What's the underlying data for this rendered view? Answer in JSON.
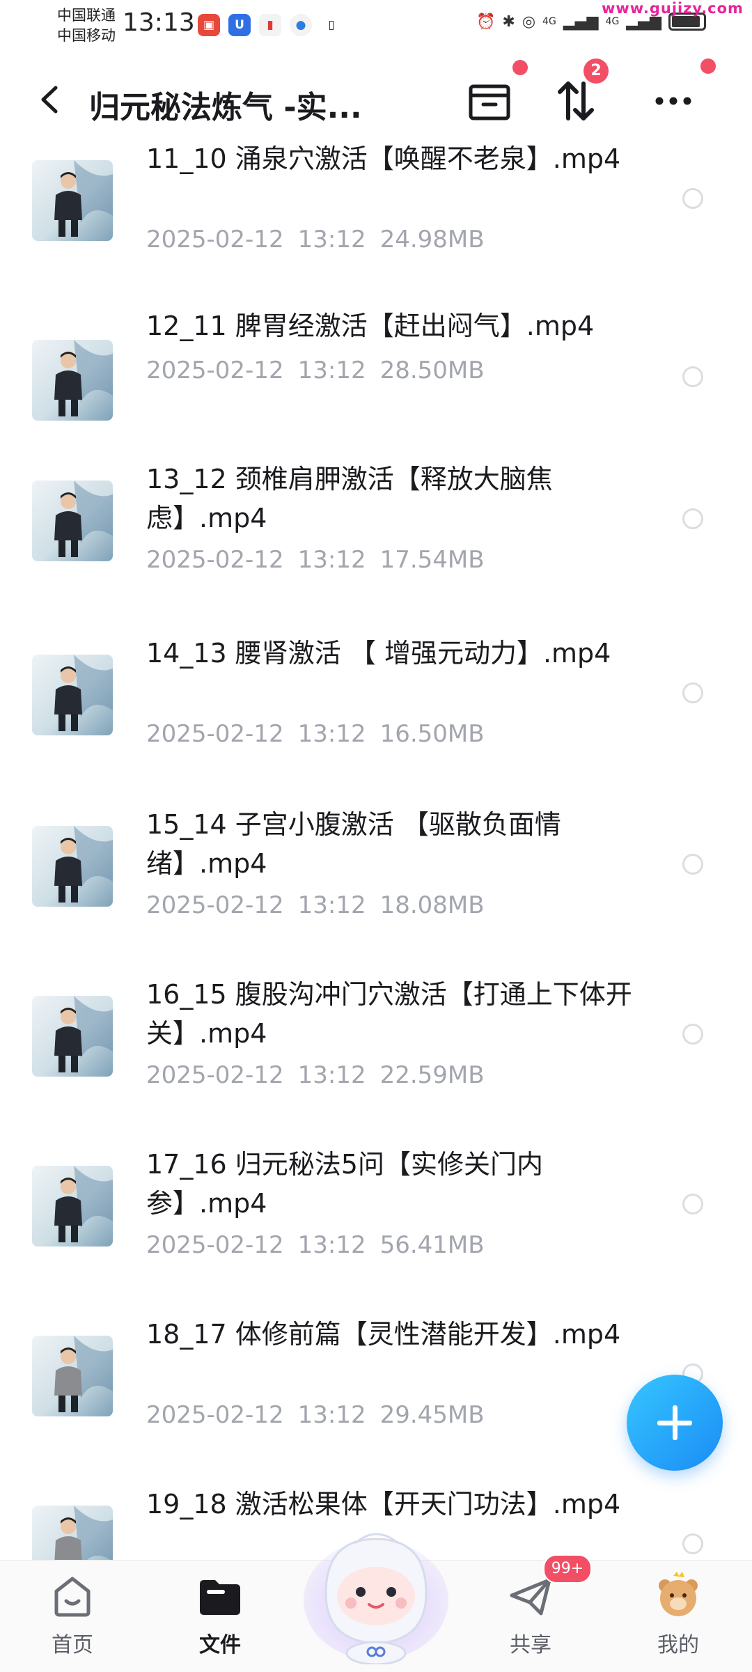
{
  "status_bar": {
    "carrier_1": "中国联通",
    "carrier_2": "中国移动",
    "time": "13:13",
    "network_1": "4G",
    "network_2": "4G",
    "watermark": "www.gujizy.com"
  },
  "header": {
    "title": "归元秘法炼气 -实...",
    "sort_badge": "2"
  },
  "files": [
    {
      "name": "11_10 涌泉穴激活【唤醒不老泉】.mp4",
      "date": "2025-02-12",
      "time": "13:12",
      "size": "24.98MB"
    },
    {
      "name": "12_11 脾胃经激活【赶出闷气】.mp4",
      "date": "2025-02-12",
      "time": "13:12",
      "size": "28.50MB"
    },
    {
      "name": "13_12 颈椎肩胛激活【释放大脑焦虑】.mp4",
      "date": "2025-02-12",
      "time": "13:12",
      "size": "17.54MB"
    },
    {
      "name": "14_13 腰肾激活 【 增强元动力】.mp4",
      "date": "2025-02-12",
      "time": "13:12",
      "size": "16.50MB"
    },
    {
      "name": "15_14 子宫小腹激活 【驱散负面情绪】.mp4",
      "date": "2025-02-12",
      "time": "13:12",
      "size": "18.08MB"
    },
    {
      "name": "16_15 腹股沟冲门穴激活【打通上下体开关】.mp4",
      "date": "2025-02-12",
      "time": "13:12",
      "size": "22.59MB"
    },
    {
      "name": "17_16 归元秘法5问【实修关门内参】.mp4",
      "date": "2025-02-12",
      "time": "13:12",
      "size": "56.41MB"
    },
    {
      "name": "18_17 体修前篇【灵性潜能开发】.mp4",
      "date": "2025-02-12",
      "time": "13:12",
      "size": "29.45MB"
    },
    {
      "name": "19_18 激活松果体【开天门功法】.mp4",
      "date": "",
      "time": "",
      "size": ""
    }
  ],
  "bottom_nav": {
    "home": "首页",
    "files": "文件",
    "share": "共享",
    "mine": "我的",
    "share_badge": "99+"
  },
  "colors": {
    "accent": "#1a8cf5",
    "badge": "#f24e66",
    "meta_text": "#a2a5ad"
  }
}
